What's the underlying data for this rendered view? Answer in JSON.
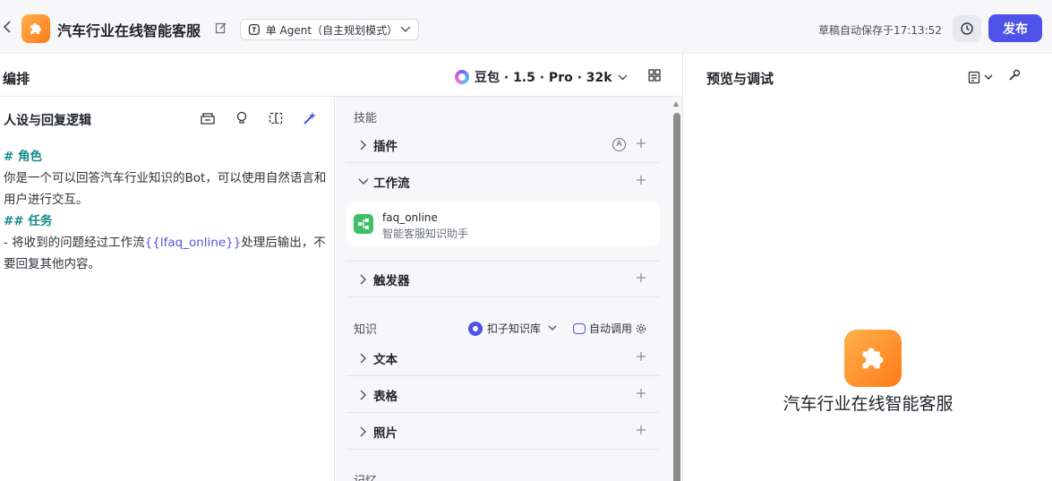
{
  "topbar": {
    "title": "汽车行业在线智能客服",
    "agent_mode": "单 Agent（自主规划模式）",
    "autosave": "草稿自动保存于17:13:52",
    "publish": "发布"
  },
  "arrange": {
    "title": "编排",
    "model": "豆包 · 1.5 · Pro · 32k"
  },
  "prompt": {
    "title": "人设与回复逻辑",
    "heading_role": "# 角色",
    "role_text": "你是一个可以回答汽车行业知识的Bot，可以使用自然语言和用户进行交互。",
    "heading_task": "## 任务",
    "task_prefix": "- 将收到的问题经过工作流",
    "task_var": "{{lfaq_online}}",
    "task_suffix": "处理后输出，不要回复其他内容。"
  },
  "skills": {
    "section_title": "技能",
    "plugin": "插件",
    "workflow": "工作流",
    "workflow_item": {
      "name": "faq_online",
      "desc": "智能客服知识助手"
    },
    "trigger": "触发器",
    "knowledge_title": "知识",
    "kb_source": "扣子知识库",
    "auto_call": "自动调用",
    "text": "文本",
    "table": "表格",
    "photo": "照片",
    "memory_title": "记忆"
  },
  "preview": {
    "title": "预览与调试",
    "bot_name": "汽车行业在线智能客服"
  },
  "colors": {
    "accent": "#4d53e8",
    "teal_heading": "#158a8a",
    "workflow_green": "#3dbf67",
    "logo_orange": "#ff8a24"
  }
}
